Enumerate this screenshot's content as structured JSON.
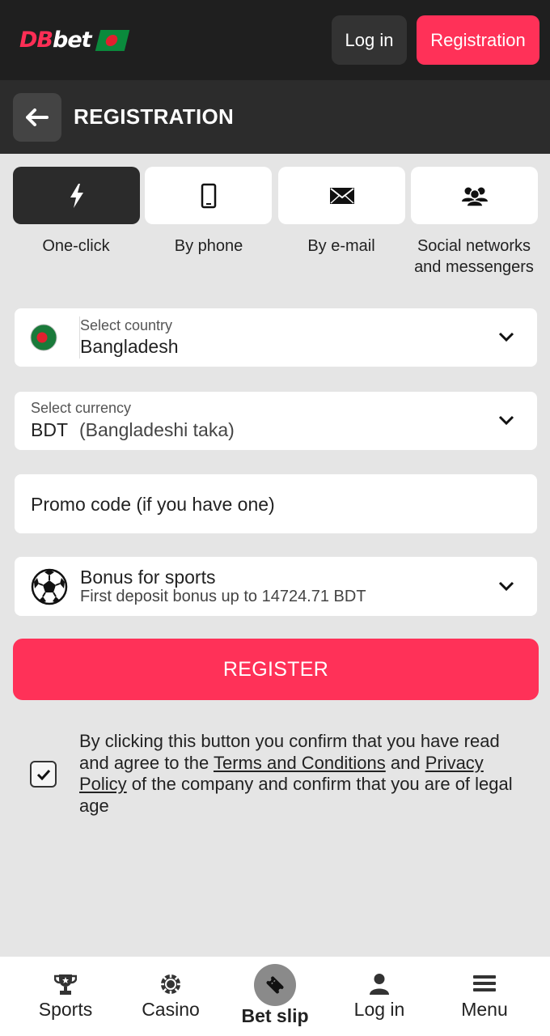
{
  "header": {
    "logo": {
      "part1": "DB",
      "part2": "bet",
      "flag_icon": "bangladesh-flag-icon"
    },
    "login_label": "Log in",
    "registration_label": "Registration"
  },
  "titlebar": {
    "back_icon": "arrow-left-icon",
    "title": "REGISTRATION"
  },
  "methods": [
    {
      "label": "One-click",
      "icon": "lightning-icon",
      "active": true
    },
    {
      "label": "By phone",
      "icon": "phone-icon",
      "active": false
    },
    {
      "label": "By e-mail",
      "icon": "envelope-icon",
      "active": false
    },
    {
      "label": "Social networks and messengers",
      "icon": "users-icon",
      "active": false
    }
  ],
  "form": {
    "country": {
      "label": "Select country",
      "value": "Bangladesh"
    },
    "currency": {
      "label": "Select currency",
      "code": "BDT",
      "name": "(Bangladeshi taka)"
    },
    "promo": {
      "placeholder": "Promo code (if you have one)"
    },
    "bonus": {
      "title": "Bonus for sports",
      "subtitle": "First deposit bonus up to 14724.71 BDT"
    },
    "register_label": "REGISTER",
    "consent": {
      "checked": true,
      "text_before": "By clicking this button you confirm that you have read and agree to the ",
      "terms_link": "Terms and Conditions",
      "text_middle": " and ",
      "privacy_link": "Privacy Policy",
      "text_after": " of the company and confirm that you are of legal age"
    }
  },
  "bottom_nav": [
    {
      "label": "Sports",
      "icon": "trophy-icon"
    },
    {
      "label": "Casino",
      "icon": "casino-chip-icon"
    },
    {
      "label": "Bet slip",
      "icon": "ticket-icon"
    },
    {
      "label": "Log in",
      "icon": "user-icon"
    },
    {
      "label": "Menu",
      "icon": "hamburger-icon"
    }
  ],
  "colors": {
    "accent": "#ff3158",
    "header_bg": "#1f1f1f",
    "titlebar_bg": "#2c2c2c",
    "page_bg": "#e5e5e5"
  }
}
